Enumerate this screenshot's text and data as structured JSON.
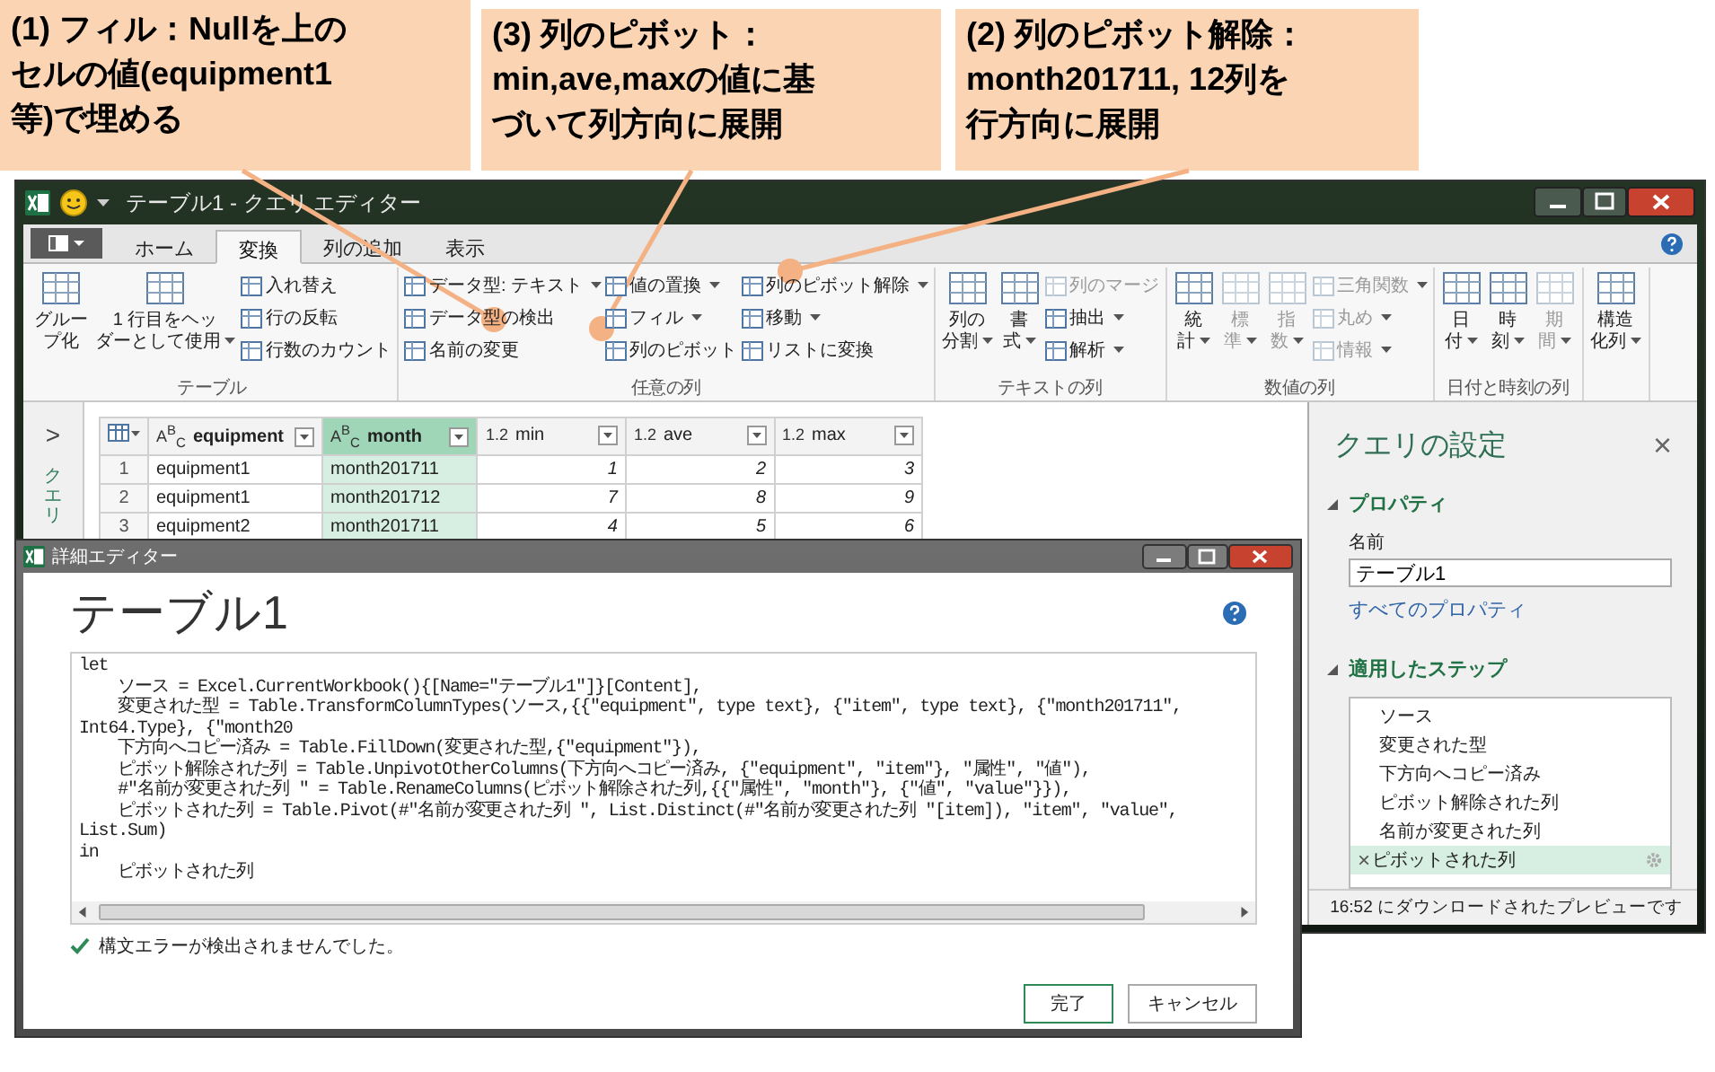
{
  "callouts": [
    {
      "lines": [
        "(1) フィル：Nullを上の",
        "セルの値(equipment1",
        "等)で埋める"
      ]
    },
    {
      "lines": [
        "(3) 列のピボット：",
        "min,ave,maxの値に基",
        "づいて列方向に展開"
      ]
    },
    {
      "lines": [
        "(2) 列のピボット解除：",
        "month201711, 12列を",
        "行方向に展開"
      ]
    }
  ],
  "window": {
    "title": "テーブル1 - クエリ エディター",
    "tabs": [
      {
        "label": "ホーム",
        "selected": false
      },
      {
        "label": "変換",
        "selected": true
      },
      {
        "label": "列の追加",
        "selected": false
      },
      {
        "label": "表示",
        "selected": false
      }
    ]
  },
  "ribbon": {
    "groups": [
      {
        "label": "テーブル",
        "large": [
          {
            "lines": [
              "グルー",
              "プ化"
            ],
            "dropdown": false,
            "disabled": false
          },
          {
            "lines": [
              "1 行目をヘッ",
              "ダーとして使用"
            ],
            "dropdown": true,
            "disabled": false
          }
        ],
        "columns": [
          [
            {
              "label": "入れ替え",
              "dropdown": false,
              "disabled": false
            },
            {
              "label": "行の反転",
              "dropdown": false,
              "disabled": false
            },
            {
              "label": "行数のカウント",
              "dropdown": false,
              "disabled": false
            }
          ]
        ]
      },
      {
        "label": "任意の列",
        "columns": [
          [
            {
              "label": "データ型: テキスト",
              "dropdown": true,
              "disabled": false
            },
            {
              "label": "データ型の検出",
              "dropdown": false,
              "disabled": false
            },
            {
              "label": "名前の変更",
              "dropdown": false,
              "disabled": false
            }
          ],
          [
            {
              "label": "値の置換",
              "dropdown": true,
              "disabled": false
            },
            {
              "label": "フィル",
              "dropdown": true,
              "disabled": false
            },
            {
              "label": "列のピボット",
              "dropdown": false,
              "disabled": false
            }
          ],
          [
            {
              "label": "列のピボット解除",
              "dropdown": true,
              "disabled": false
            },
            {
              "label": "移動",
              "dropdown": true,
              "disabled": false
            },
            {
              "label": "リストに変換",
              "dropdown": false,
              "disabled": false
            }
          ]
        ]
      },
      {
        "label": "テキストの列",
        "large": [
          {
            "lines": [
              "列の",
              "分割"
            ],
            "dropdown": true,
            "disabled": false
          },
          {
            "lines": [
              "書",
              "式"
            ],
            "dropdown": true,
            "disabled": false
          }
        ],
        "columns": [
          [
            {
              "label": "列のマージ",
              "dropdown": false,
              "disabled": true
            },
            {
              "label": "抽出",
              "dropdown": true,
              "disabled": false
            },
            {
              "label": "解析",
              "dropdown": true,
              "disabled": false
            }
          ]
        ]
      },
      {
        "label": "数値の列",
        "large": [
          {
            "lines": [
              "統",
              "計"
            ],
            "dropdown": true,
            "disabled": false
          },
          {
            "lines": [
              "標",
              "準"
            ],
            "dropdown": true,
            "disabled": true
          },
          {
            "lines": [
              "指",
              "数"
            ],
            "dropdown": true,
            "disabled": true
          }
        ],
        "columns": [
          [
            {
              "label": "三角関数",
              "dropdown": true,
              "disabled": true
            },
            {
              "label": "丸め",
              "dropdown": true,
              "disabled": true
            },
            {
              "label": "情報",
              "dropdown": true,
              "disabled": true
            }
          ]
        ]
      },
      {
        "label": "日付と時刻の列",
        "large": [
          {
            "lines": [
              "日",
              "付"
            ],
            "dropdown": true,
            "disabled": false
          },
          {
            "lines": [
              "時",
              "刻"
            ],
            "dropdown": true,
            "disabled": false
          },
          {
            "lines": [
              "期",
              "間"
            ],
            "dropdown": true,
            "disabled": true
          }
        ]
      },
      {
        "large": [
          {
            "lines": [
              "構造",
              "化列"
            ],
            "dropdown": true,
            "disabled": false
          }
        ]
      }
    ]
  },
  "queries_pane": {
    "expand": ">",
    "label": "クエリ"
  },
  "table": {
    "columns": [
      {
        "type": "A$^{B}$$_{C}$",
        "name": "equipment",
        "selected": false
      },
      {
        "type": "A$^{B}$$_{C}$",
        "name": "month",
        "selected": true
      },
      {
        "type": "1.2",
        "name": "min",
        "selected": false
      },
      {
        "type": "1.2",
        "name": "ave",
        "selected": false
      },
      {
        "type": "1.2",
        "name": "max",
        "selected": false
      }
    ],
    "rows": [
      {
        "number": "1",
        "cells": [
          "equipment1",
          "month201711",
          "1",
          "2",
          "3"
        ]
      },
      {
        "number": "2",
        "cells": [
          "equipment1",
          "month201712",
          "7",
          "8",
          "9"
        ]
      },
      {
        "number": "3",
        "cells": [
          "equipment2",
          "month201711",
          "4",
          "5",
          "6"
        ]
      }
    ]
  },
  "query_settings": {
    "title": "クエリの設定",
    "close": "×",
    "properties_heading": "プロパティ",
    "name_label": "名前",
    "name_value": "テーブル1",
    "all_properties_link": "すべてのプロパティ",
    "steps_heading": "適用したステップ",
    "steps": [
      {
        "label": "ソース",
        "selected": false
      },
      {
        "label": "変更された型",
        "selected": false
      },
      {
        "label": "下方向へコピー済み",
        "selected": false
      },
      {
        "label": "ピボット解除された列",
        "selected": false
      },
      {
        "label": "名前が変更された列",
        "selected": false
      },
      {
        "label": "ピボットされた列",
        "selected": true
      }
    ],
    "delete_mark": "×",
    "status": "16:52 にダウンロードされたプレビューです"
  },
  "dialog": {
    "title": "詳細エディター",
    "heading": "テーブル1",
    "code": [
      "let",
      "    ソース = Excel.CurrentWorkbook(){[Name=\"テーブル1\"]}[Content],",
      "    変更された型 = Table.TransformColumnTypes(ソース,{{\"equipment\", type text}, {\"item\", type text}, {\"month201711\", Int64.Type}, {\"month20",
      "    下方向へコピー済み = Table.FillDown(変更された型,{\"equipment\"}),",
      "    ピボット解除された列 = Table.UnpivotOtherColumns(下方向へコピー済み, {\"equipment\", \"item\"}, \"属性\", \"値\"),",
      "    #\"名前が変更された列 \" = Table.RenameColumns(ピボット解除された列,{{\"属性\", \"month\"}, {\"値\", \"value\"}}),",
      "    ピボットされた列 = Table.Pivot(#\"名前が変更された列 \", List.Distinct(#\"名前が変更された列 \"[item]), \"item\", \"value\", List.Sum)",
      "in",
      "    ピボットされた列"
    ],
    "status": "構文エラーが検出されませんでした。",
    "buttons": [
      {
        "label": "完了",
        "default": true
      },
      {
        "label": "キャンセル",
        "default": false
      }
    ]
  }
}
